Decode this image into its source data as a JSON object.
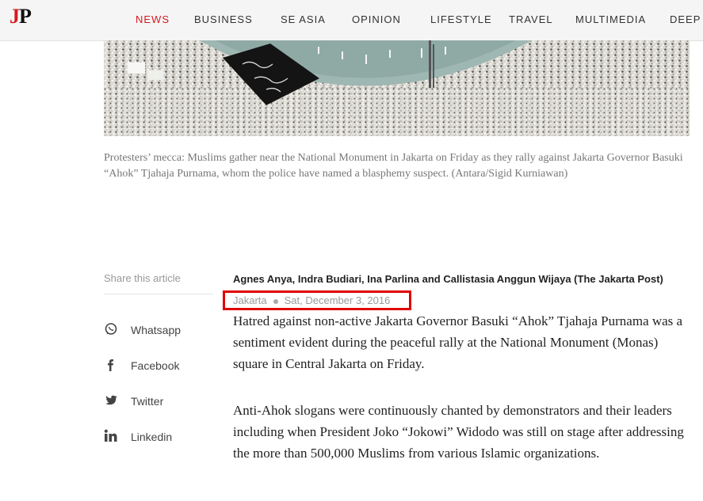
{
  "nav": {
    "logo": {
      "j": "J",
      "p": "P"
    },
    "items": [
      {
        "label": "NEWS",
        "active": true
      },
      {
        "label": "BUSINESS"
      },
      {
        "label": "SE ASIA"
      },
      {
        "label": "OPINION"
      },
      {
        "label": "LIFESTYLE"
      },
      {
        "label": "TRAVEL"
      },
      {
        "label": "MULTIMEDIA"
      },
      {
        "label": "DEEP L"
      }
    ]
  },
  "hero": {
    "caption": "Protesters’ mecca: Muslims gather near the National Monument in Jakarta on Friday as they rally against Jakarta Governor Basuki “Ahok” Tjahaja Purnama, whom the police have named a blasphemy suspect. (Antara/Sigid Kurniawan)"
  },
  "share": {
    "title": "Share this article",
    "items": [
      {
        "label": "Whatsapp",
        "icon": "whatsapp-icon"
      },
      {
        "label": "Facebook",
        "icon": "facebook-icon"
      },
      {
        "label": "Twitter",
        "icon": "twitter-icon"
      },
      {
        "label": "Linkedin",
        "icon": "linkedin-icon"
      }
    ]
  },
  "article": {
    "byline": "Agnes Anya, Indra Budiari, Ina Parlina and Callistasia Anggun Wijaya (The Jakarta Post)",
    "location": "Jakarta",
    "date": "Sat, December 3, 2016",
    "paragraphs": [
      "Hatred against non-active Jakarta Governor Basuki “Ahok” Tjahaja Purnama was a sentiment evident during the peaceful rally at the National Monument (Monas) square in Central Jakarta on Friday.",
      "Anti-Ahok slogans were continuously chanted by demonstrators and their leaders including when President Joko “Jokowi” Widodo was still on stage after addressing the more than 500,000 Muslims from various Islamic organizations."
    ]
  },
  "colors": {
    "accent": "#d71920",
    "highlight_box": "#e00000"
  }
}
